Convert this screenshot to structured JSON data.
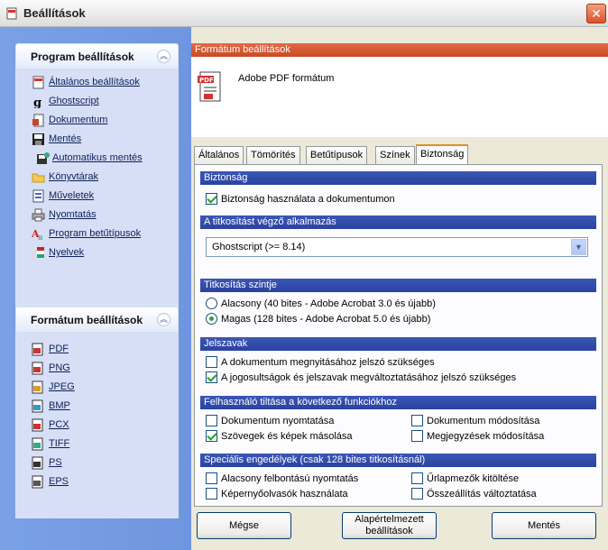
{
  "window": {
    "title": "Beállítások",
    "close_label": "✕"
  },
  "program_panel": {
    "title": "Program beállítások",
    "items": [
      {
        "label": "Általános beállítások",
        "icon": "settings-icon"
      },
      {
        "label": "Ghostscript",
        "icon": "ghostscript-icon"
      },
      {
        "label": "Dokumentum",
        "icon": "document-icon"
      },
      {
        "label": "Mentés",
        "icon": "save-icon"
      },
      {
        "label": "Automatikus mentés",
        "icon": "autosave-icon"
      },
      {
        "label": "Könyvtárak",
        "icon": "folder-icon"
      },
      {
        "label": "Műveletek",
        "icon": "actions-icon"
      },
      {
        "label": "Nyomtatás",
        "icon": "printer-icon"
      },
      {
        "label": "Program betűtípusok",
        "icon": "fonts-icon"
      },
      {
        "label": "Nyelvek",
        "icon": "language-icon"
      }
    ]
  },
  "format_panel": {
    "title": "Formátum beállítások",
    "items": [
      {
        "label": "PDF"
      },
      {
        "label": "PNG"
      },
      {
        "label": "JPEG"
      },
      {
        "label": "BMP"
      },
      {
        "label": "PCX"
      },
      {
        "label": "TIFF"
      },
      {
        "label": "PS"
      },
      {
        "label": "EPS"
      }
    ]
  },
  "format_header": {
    "bar": "Formátum beállítások",
    "name": "Adobe PDF formátum"
  },
  "tabs": [
    "Általános",
    "Tömörítés",
    "Betűtípusok",
    "Színek",
    "Biztonság"
  ],
  "active_tab": "Biztonság",
  "security": {
    "section": "Biztonság",
    "use_security": {
      "label": "Biztonság használata a dokumentumon",
      "checked": true
    },
    "encrypt_app_section": "A titkosítást végző alkalmazás",
    "encrypt_app_value": "Ghostscript (>= 8.14)",
    "level_section": "Titkosítás szintje",
    "levels": [
      {
        "label": "Alacsony (40 bites - Adobe Acrobat 3.0 és újabb)",
        "checked": false
      },
      {
        "label": "Magas (128 bites - Adobe Acrobat 5.0 és újabb)",
        "checked": true
      }
    ],
    "passwords_section": "Jelszavak",
    "passwords": [
      {
        "label": "A dokumentum megnyitásához jelszó szükséges",
        "checked": false
      },
      {
        "label": "A jogosultságok és jelszavak megváltoztatásához jelszó szükséges",
        "checked": true
      }
    ],
    "deny_section": "Felhasználó tiltása a következő funkciókhoz",
    "deny": [
      {
        "label": "Dokumentum nyomtatása",
        "checked": false
      },
      {
        "label": "Dokumentum módosítása",
        "checked": false
      },
      {
        "label": "Szövegek és képek másolása",
        "checked": true
      },
      {
        "label": "Megjegyzések módosítása",
        "checked": false
      }
    ],
    "special_section": "Speciális engedélyek (csak 128 bites titkosításnál)",
    "special": [
      {
        "label": "Alacsony felbontású nyomtatás",
        "checked": false
      },
      {
        "label": "Űrlapmezők kitöltése",
        "checked": false
      },
      {
        "label": "Képernyőolvasók használata",
        "checked": false
      },
      {
        "label": "Összeállítás változtatása",
        "checked": false
      }
    ]
  },
  "buttons": {
    "cancel": "Mégse",
    "defaults_line1": "Alapértelmezett",
    "defaults_line2": "beállítások",
    "save": "Mentés"
  }
}
